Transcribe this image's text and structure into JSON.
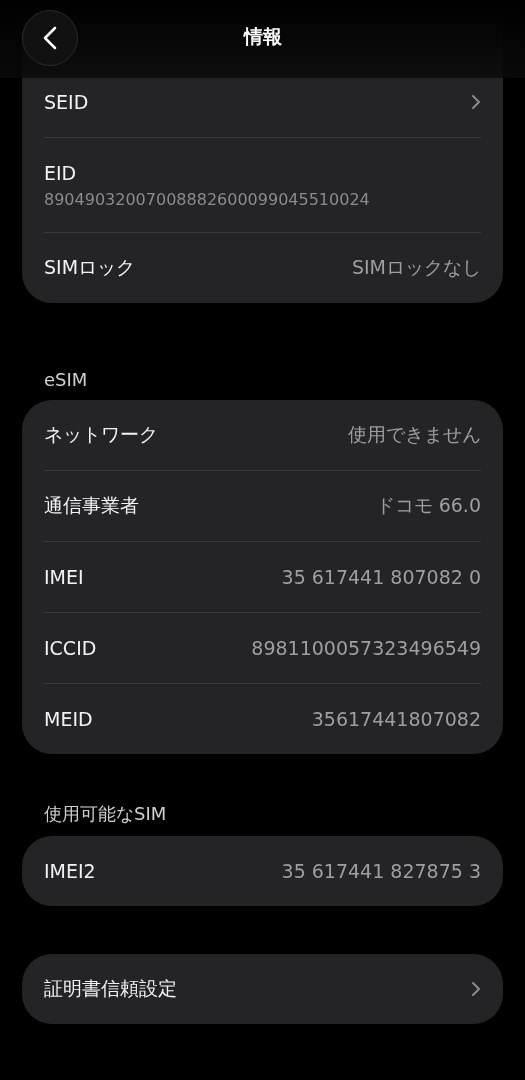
{
  "header": {
    "title": "情報"
  },
  "sections": [
    {
      "rows": [
        {
          "kind": "link",
          "label": "SEID"
        },
        {
          "kind": "stacked",
          "label": "EID",
          "value": "89049032007008882600099045510024"
        },
        {
          "kind": "value",
          "label": "SIMロック",
          "value": "SIMロックなし"
        }
      ]
    },
    {
      "title": "eSIM",
      "rows": [
        {
          "kind": "value",
          "label": "ネットワーク",
          "value": "使用できません"
        },
        {
          "kind": "value",
          "label": "通信事業者",
          "value": "ドコモ 66.0"
        },
        {
          "kind": "value",
          "label": "IMEI",
          "value": "35 617441 807082 0"
        },
        {
          "kind": "value",
          "label": "ICCID",
          "value": "8981100057323496549"
        },
        {
          "kind": "value",
          "label": "MEID",
          "value": "35617441807082"
        }
      ]
    },
    {
      "title": "使用可能なSIM",
      "rows": [
        {
          "kind": "value",
          "label": "IMEI2",
          "value": "35 617441 827875 3"
        }
      ]
    },
    {
      "rows": [
        {
          "kind": "link",
          "label": "証明書信頼設定"
        }
      ]
    }
  ]
}
